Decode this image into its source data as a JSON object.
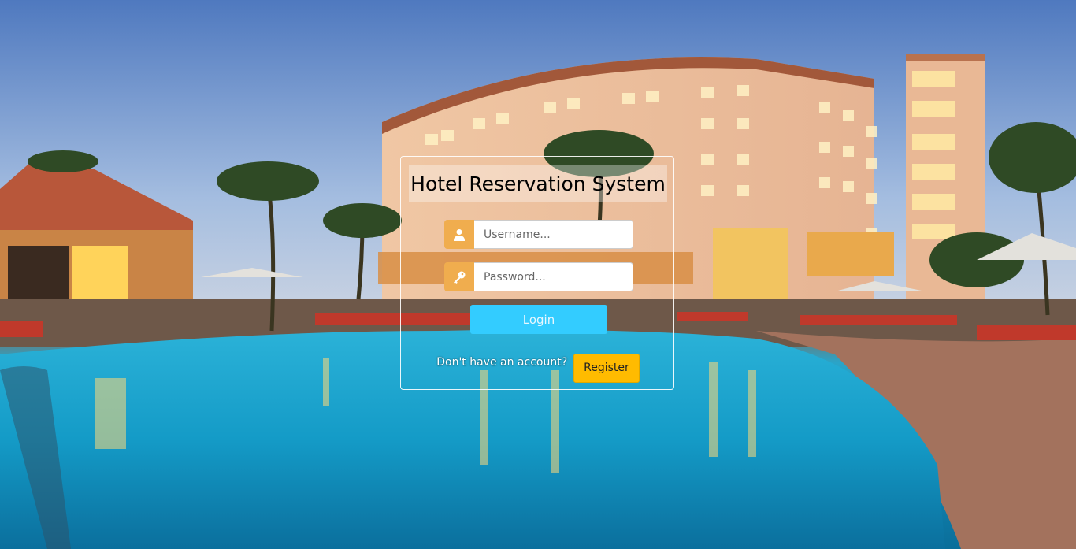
{
  "page": {
    "title": "Hotel Reservation System"
  },
  "login": {
    "username_placeholder": "Username...",
    "password_placeholder": "Password...",
    "username_value": "",
    "password_value": "",
    "login_label": "Login",
    "register_prompt": "Don't have an account?",
    "register_label": "Register"
  },
  "icons": {
    "username": "user-icon",
    "password": "key-icon"
  },
  "colors": {
    "addon": "#f0ad4e",
    "login_button": "#33ccff",
    "register_button": "#ffbb00"
  }
}
